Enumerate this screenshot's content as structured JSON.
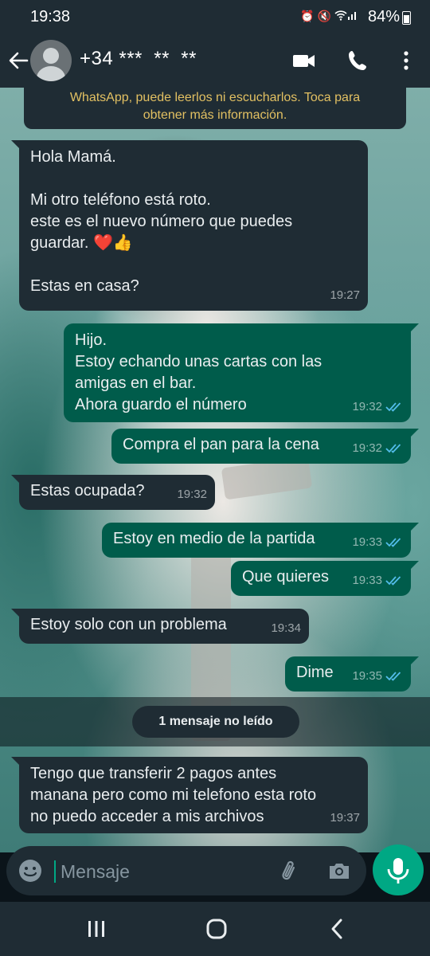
{
  "status_bar": {
    "time": "19:38",
    "battery": "84%",
    "icons": [
      "alarm-icon",
      "mute-icon",
      "wifi-icon",
      "signal-icon",
      "battery-icon"
    ]
  },
  "header": {
    "contact": "+34 ***  **  **",
    "icons": [
      "back-arrow-icon",
      "avatar",
      "video-call-icon",
      "phone-icon",
      "more-vert-icon"
    ]
  },
  "notice": {
    "line1": "WhatsApp, puede leerlos ni escucharlos. Toca para",
    "line2": "obtener más información."
  },
  "messages": [
    {
      "direction": "in",
      "text": "Hola Mamá.\n\nMi otro teléfono está roto.\neste es el nuevo número que puedes\nguardar. ❤️👍\n\nEstas en casa?",
      "time": "19:27"
    },
    {
      "direction": "out",
      "text": "Hijo.\nEstoy echando unas cartas con las\namigas en el bar.\nAhora guardo el número",
      "time": "19:32",
      "read": true
    },
    {
      "direction": "out",
      "text": "Compra el pan para la cena",
      "time": "19:32",
      "read": true
    },
    {
      "direction": "in",
      "text": "Estas ocupada?",
      "time": "19:32"
    },
    {
      "direction": "out",
      "text": "Estoy en medio de la partida",
      "time": "19:33",
      "read": true
    },
    {
      "direction": "out",
      "text": "Que quieres",
      "time": "19:33",
      "read": true
    },
    {
      "direction": "in",
      "text": "Estoy solo con un problema",
      "time": "19:34"
    },
    {
      "direction": "out",
      "text": "Dime",
      "time": "19:35",
      "read": true
    },
    {
      "direction": "in",
      "text": "Tengo que transferir 2 pagos antes\nmanana pero como mi telefono esta roto\nno puedo acceder a mis archivos",
      "time": "19:37"
    }
  ],
  "unread_label": "1 mensaje no leído",
  "composer": {
    "placeholder": "Mensaje",
    "icons": [
      "emoji-icon",
      "attach-icon",
      "camera-icon",
      "mic-icon"
    ]
  },
  "colors": {
    "incoming_bubble": "#1f2c34",
    "outgoing_bubble": "#005c4b",
    "accent": "#00a884",
    "read_ticks": "#53bdeb",
    "notice_text": "#e2c062"
  }
}
